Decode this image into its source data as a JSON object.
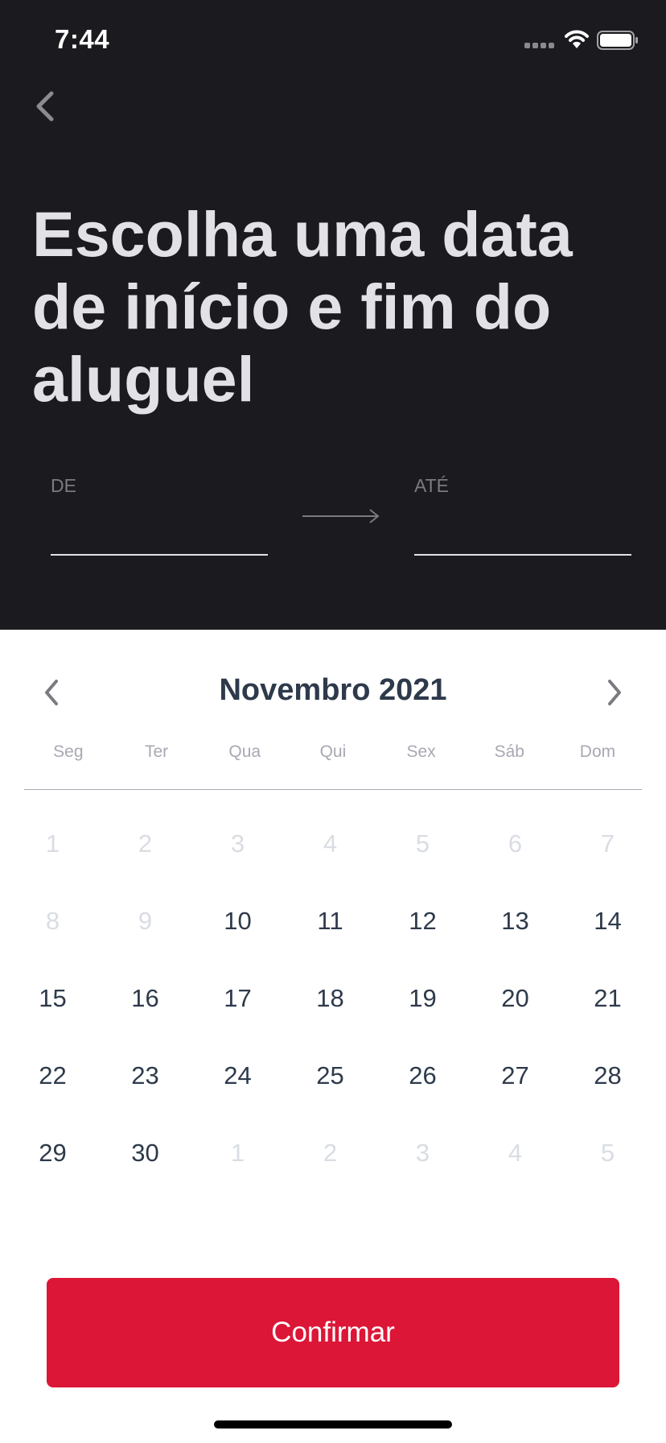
{
  "status_bar": {
    "time": "7:44",
    "icons": [
      "cellular-signal-icon",
      "wifi-icon",
      "battery-icon"
    ]
  },
  "header": {
    "back_icon": "chevron-left-icon",
    "title": "Escolha uma data de início e fim do aluguel"
  },
  "date_range": {
    "from_label": "DE",
    "from_value": "",
    "to_label": "ATÉ",
    "to_value": "",
    "arrow_icon": "arrow-right-icon"
  },
  "calendar": {
    "month_title": "Novembro 2021",
    "prev_icon": "chevron-left-icon",
    "next_icon": "chevron-right-icon",
    "weekdays": [
      "Seg",
      "Ter",
      "Qua",
      "Qui",
      "Sex",
      "Sáb",
      "Dom"
    ],
    "days": [
      {
        "label": "1",
        "disabled": true
      },
      {
        "label": "2",
        "disabled": true
      },
      {
        "label": "3",
        "disabled": true
      },
      {
        "label": "4",
        "disabled": true
      },
      {
        "label": "5",
        "disabled": true
      },
      {
        "label": "6",
        "disabled": true
      },
      {
        "label": "7",
        "disabled": true
      },
      {
        "label": "8",
        "disabled": true
      },
      {
        "label": "9",
        "disabled": true
      },
      {
        "label": "10",
        "disabled": false
      },
      {
        "label": "11",
        "disabled": false
      },
      {
        "label": "12",
        "disabled": false
      },
      {
        "label": "13",
        "disabled": false
      },
      {
        "label": "14",
        "disabled": false
      },
      {
        "label": "15",
        "disabled": false
      },
      {
        "label": "16",
        "disabled": false
      },
      {
        "label": "17",
        "disabled": false
      },
      {
        "label": "18",
        "disabled": false
      },
      {
        "label": "19",
        "disabled": false
      },
      {
        "label": "20",
        "disabled": false
      },
      {
        "label": "21",
        "disabled": false
      },
      {
        "label": "22",
        "disabled": false
      },
      {
        "label": "23",
        "disabled": false
      },
      {
        "label": "24",
        "disabled": false
      },
      {
        "label": "25",
        "disabled": false
      },
      {
        "label": "26",
        "disabled": false
      },
      {
        "label": "27",
        "disabled": false
      },
      {
        "label": "28",
        "disabled": false
      },
      {
        "label": "29",
        "disabled": false
      },
      {
        "label": "30",
        "disabled": false
      },
      {
        "label": "1",
        "disabled": true
      },
      {
        "label": "2",
        "disabled": true
      },
      {
        "label": "3",
        "disabled": true
      },
      {
        "label": "4",
        "disabled": true
      },
      {
        "label": "5",
        "disabled": true
      }
    ]
  },
  "confirm": {
    "label": "Confirmar"
  },
  "colors": {
    "header_bg": "#1b1b1f",
    "title": "#e1e1e6",
    "accent_button": "#dc1637",
    "day_text": "#2e3a4b",
    "day_disabled": "#d9dde3",
    "weekday_text": "#a8a8b3"
  }
}
